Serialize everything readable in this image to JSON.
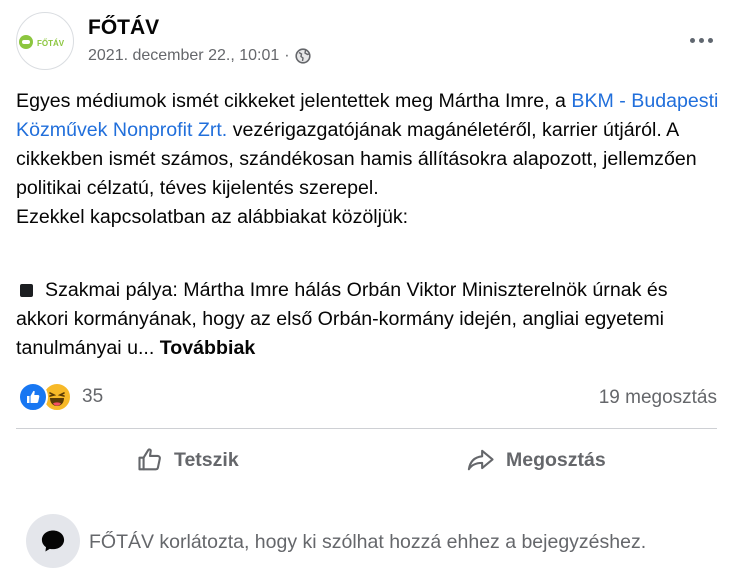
{
  "post": {
    "author": "FŐTÁV",
    "avatar_text": "FŐTÁV",
    "timestamp": "2021. december 22., 10:01",
    "separator": "·",
    "privacy_icon": "globe-icon",
    "more_icon": "more-options-icon",
    "body": {
      "text_before_link": "Egyes médiumok ismét cikkeket jelentettek meg Mártha Imre, a ",
      "link_text": "BKM - Budapesti Közművek Nonprofit Zrt.",
      "text_after_link": " vezérigazgatójának magánéletéről, karrier útjáról. A cikkekben ismét számos, szándékosan hamis állításokra alapozott, jellemzően politikai célzatú, téves kijelentés szerepel.",
      "line2": "Ezekkel kapcsolatban az alábbiakat közöljük:",
      "bullet_text": "Szakmai pálya: Mártha Imre hálás Orbán Viktor Miniszterelnök úrnak és akkori kormányának, hogy az első Orbán-kormány idején, angliai egyetemi tanulmányai u...",
      "see_more": "Továbbiak"
    },
    "stats": {
      "reaction_icons": [
        "like-reaction-icon",
        "haha-reaction-icon"
      ],
      "reaction_count": "35",
      "shares": "19 megosztás"
    },
    "actions": {
      "like_label": "Tetszik",
      "share_label": "Megosztás"
    },
    "restriction_notice": "FŐTÁV korlátozta, hogy ki szólhat hozzá ehhez a bejegyzéshez."
  },
  "colors": {
    "link": "#216fdb",
    "secondary_text": "#65676b",
    "like_blue": "#1877f2",
    "haha_yellow": "#f7b928",
    "brand_green": "#8cc63f"
  }
}
